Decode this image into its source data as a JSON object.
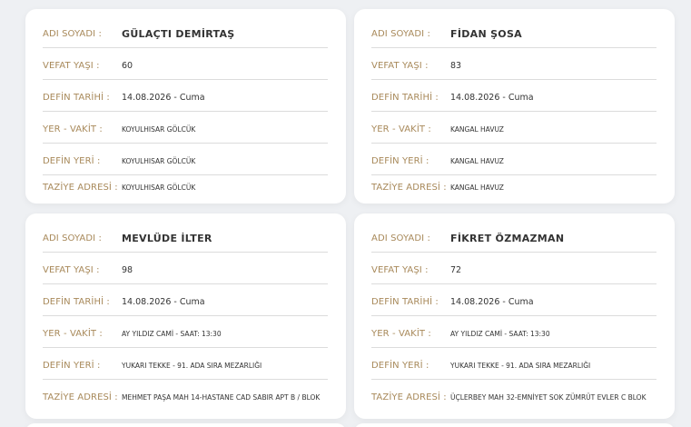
{
  "labels": {
    "name": "ADI SOYADI :",
    "age": "VEFAT YAŞI :",
    "date": "DEFİN TARİHİ :",
    "place_time": "YER - VAKİT :",
    "burial": "DEFİN YERİ :",
    "condolence": "TAZİYE ADRESİ :"
  },
  "cards": [
    {
      "name": "GÜLAÇTI DEMİRTAŞ",
      "age": "60",
      "date": "14.08.2026 - Cuma",
      "place_time": "KOYULHISAR GÖLCÜK",
      "burial": "KOYULHISAR GÖLCÜK",
      "condolence": "KOYULHISAR GÖLCÜK"
    },
    {
      "name": "FİDAN ŞOSA",
      "age": "83",
      "date": "14.08.2026 - Cuma",
      "place_time": "KANGAL HAVUZ",
      "burial": "KANGAL HAVUZ",
      "condolence": "KANGAL HAVUZ"
    },
    {
      "name": "MEVLÜDE İLTER",
      "age": "98",
      "date": "14.08.2026 - Cuma",
      "place_time": "AY YILDIZ CAMİ - SAAT: 13:30",
      "burial": "YUKARI TEKKE - 91. ADA SIRA MEZARLIĞI",
      "condolence": "MEHMET PAŞA MAH 14-HASTANE CAD SABIR APT B / BLOK"
    },
    {
      "name": "FİKRET ÖZMAZMAN",
      "age": "72",
      "date": "14.08.2026 - Cuma",
      "place_time": "AY YILDIZ CAMİ - SAAT: 13:30",
      "burial": "YUKARI TEKKE - 91. ADA SIRA MEZARLIĞI",
      "condolence": "ÜÇLERBEY MAH 32-EMNİYET SOK ZÜMRÜT EVLER C BLOK"
    }
  ]
}
